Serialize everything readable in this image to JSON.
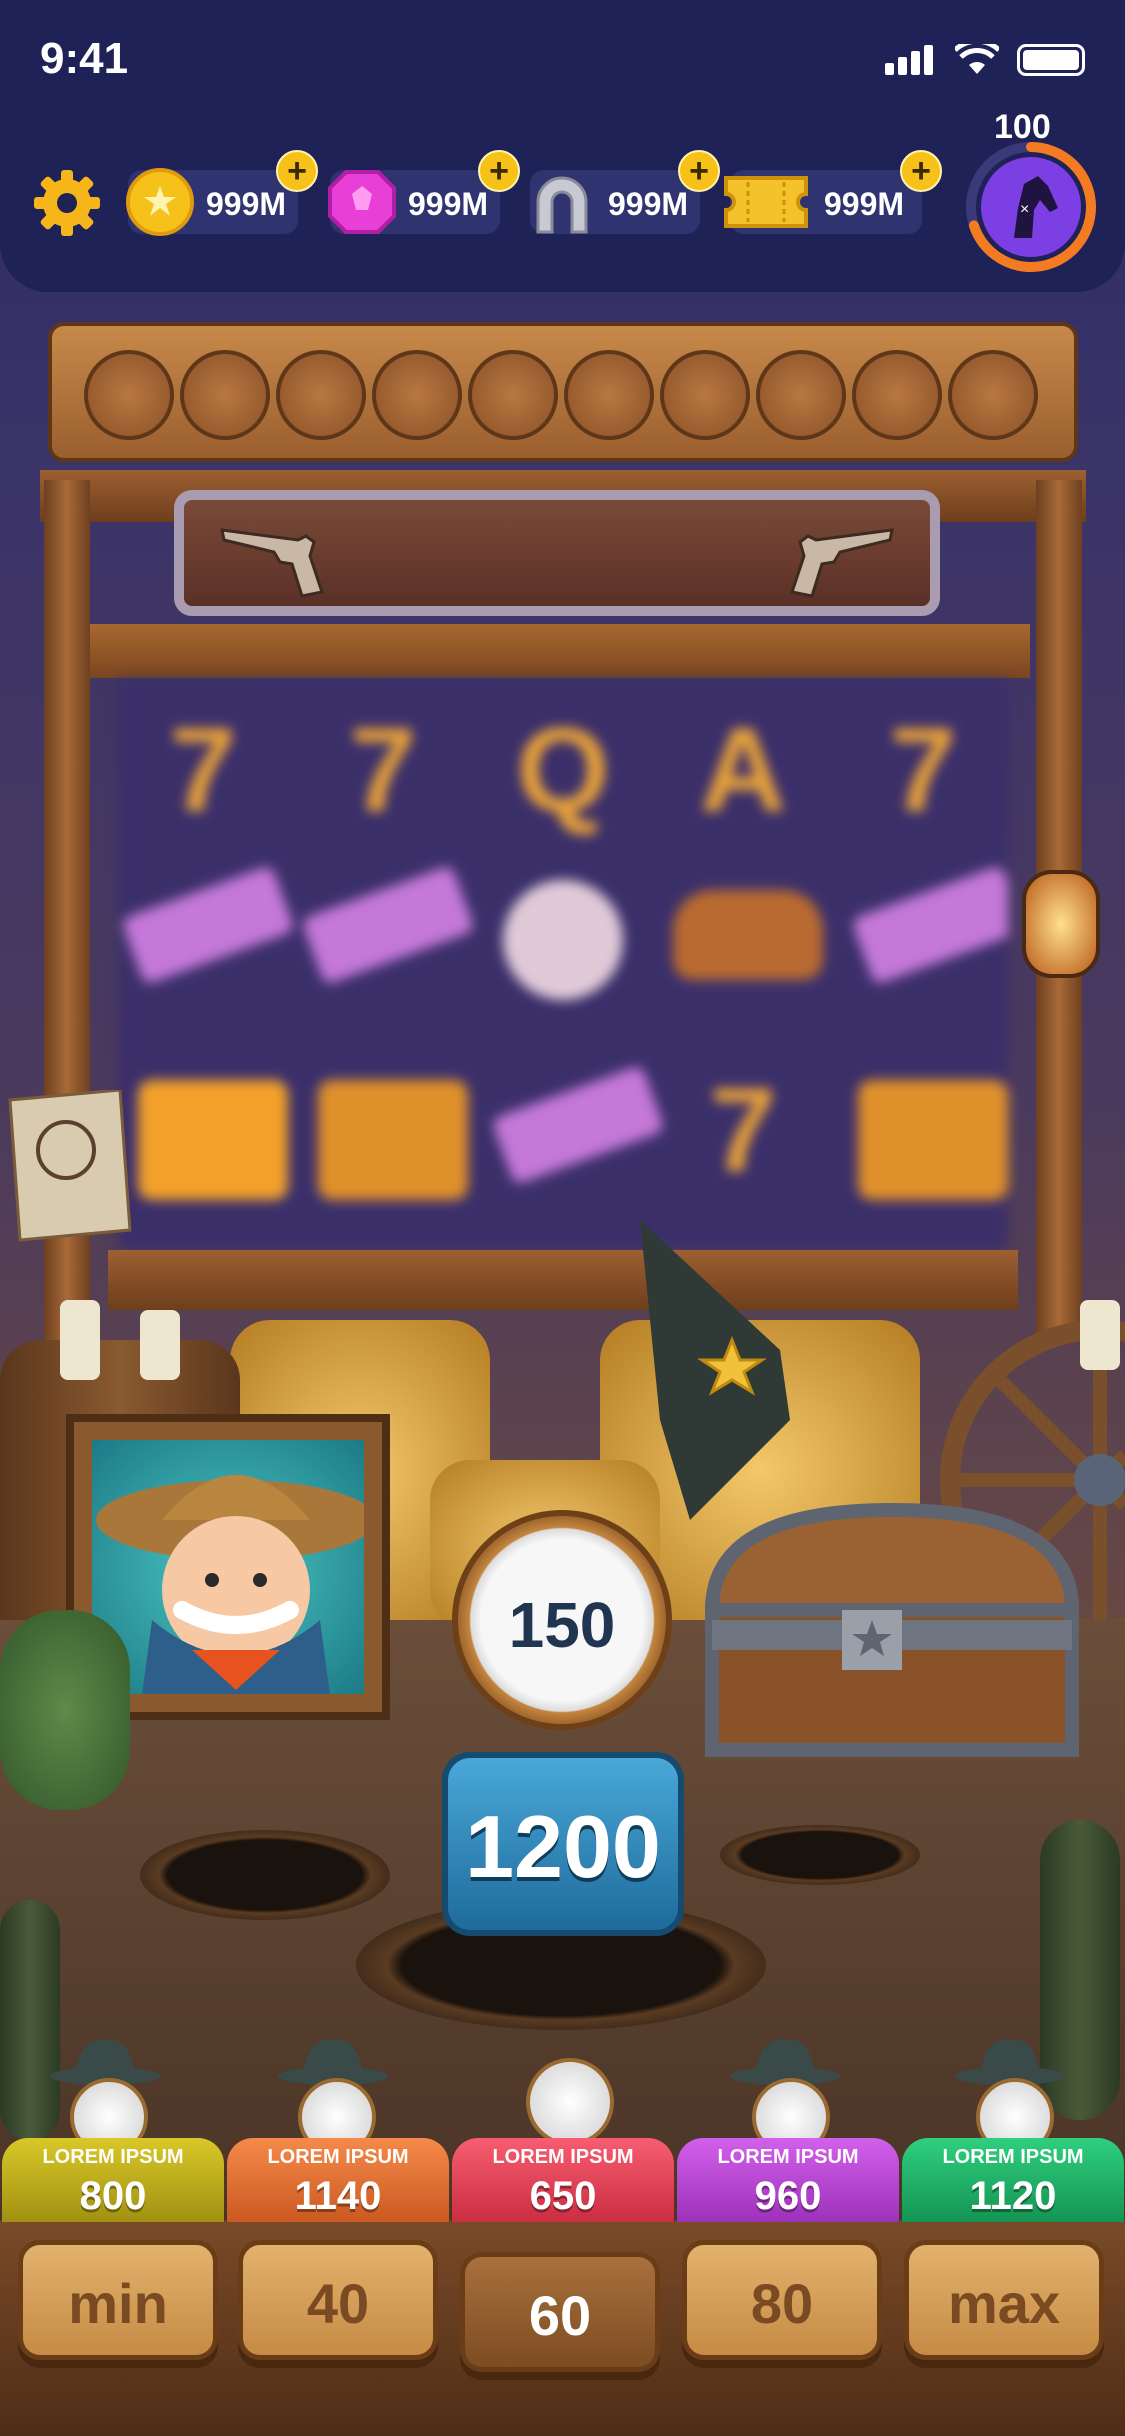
{
  "status_bar": {
    "time": "9:41"
  },
  "header": {
    "currencies": [
      {
        "icon": "coin-icon",
        "value": "999M",
        "color": "#f6c21a"
      },
      {
        "icon": "gem-icon",
        "value": "999M",
        "color": "#e83fd6"
      },
      {
        "icon": "horseshoe-icon",
        "value": "999M",
        "color": "#b9b9c4"
      },
      {
        "icon": "ticket-icon",
        "value": "999M",
        "color": "#f4c22a"
      }
    ],
    "level": "100",
    "level_progress": 0.7
  },
  "game": {
    "reel_symbols": [
      [
        "7",
        "7",
        "Q",
        "A",
        "7"
      ],
      [
        "gun",
        "gun",
        "skull",
        "hat",
        "gun"
      ],
      [
        "bar",
        "bar",
        "gun",
        "7",
        "bar"
      ]
    ],
    "bonus_value": "150",
    "win_value": "1200",
    "pockets": [
      {
        "label": "LOREM IPSUM",
        "value": "800",
        "color": "#c8b81e"
      },
      {
        "label": "LOREM IPSUM",
        "value": "1140",
        "color": "#f07a3a"
      },
      {
        "label": "LOREM IPSUM",
        "value": "650",
        "color": "#ef4a5c"
      },
      {
        "label": "LOREM IPSUM",
        "value": "960",
        "color": "#c04fdb"
      },
      {
        "label": "LOREM IPSUM",
        "value": "1120",
        "color": "#20b86a"
      }
    ]
  },
  "bets": [
    {
      "label": "min"
    },
    {
      "label": "40"
    },
    {
      "label": "60",
      "selected": true
    },
    {
      "label": "80"
    },
    {
      "label": "max"
    }
  ]
}
